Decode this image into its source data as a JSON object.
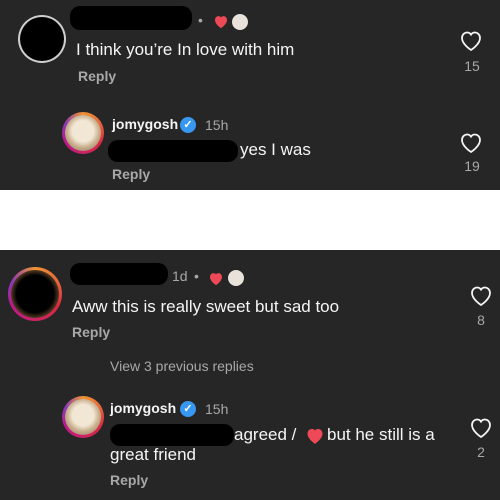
{
  "thread1": {
    "comment": {
      "text": "I think you’re In love with him",
      "reply_label": "Reply",
      "likes": "15"
    },
    "reply": {
      "username": "jomygosh",
      "time": "15h",
      "text": "yes I was",
      "reply_label": "Reply",
      "likes": "19"
    }
  },
  "thread2": {
    "comment": {
      "time": "1d",
      "text": "Aww this is really sweet but sad too",
      "reply_label": "Reply",
      "likes": "8"
    },
    "view_replies": "View 3 previous replies",
    "reply": {
      "username": "jomygosh",
      "time": "15h",
      "text_part1": "agreed /",
      "text_part2": "but he still is a",
      "text_line2": "great friend",
      "reply_label": "Reply",
      "likes": "2"
    }
  },
  "colors": {
    "background": "#262626",
    "heart": "#ed4956",
    "verified": "#3897f0",
    "text": "#f5f5f5",
    "muted": "#a8a8a8"
  }
}
